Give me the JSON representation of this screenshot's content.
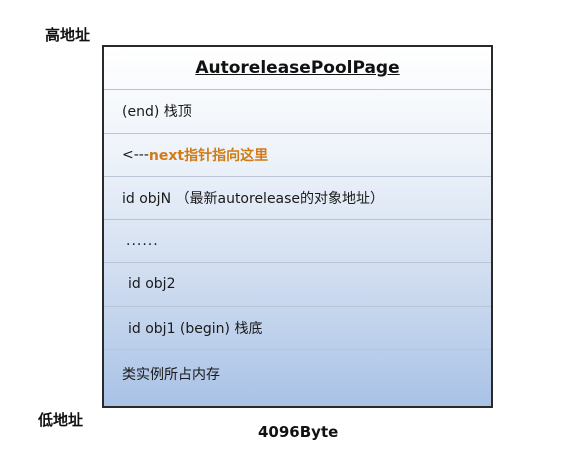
{
  "labels": {
    "high_address": "高地址",
    "low_address": "低地址",
    "page_size": "4096Byte"
  },
  "page": {
    "title": "AutoreleasePoolPage",
    "rows": {
      "stack_top": "(end) 栈顶",
      "next_arrow": "<---",
      "next_text": "next指针指向这里",
      "obj_n": "id objN  （最新autorelease的对象地址）",
      "ellipsis": "......",
      "obj_2": "id obj2",
      "obj_1": "id obj1 (begin) 栈底",
      "class_memory": "类实例所占内存"
    }
  }
}
